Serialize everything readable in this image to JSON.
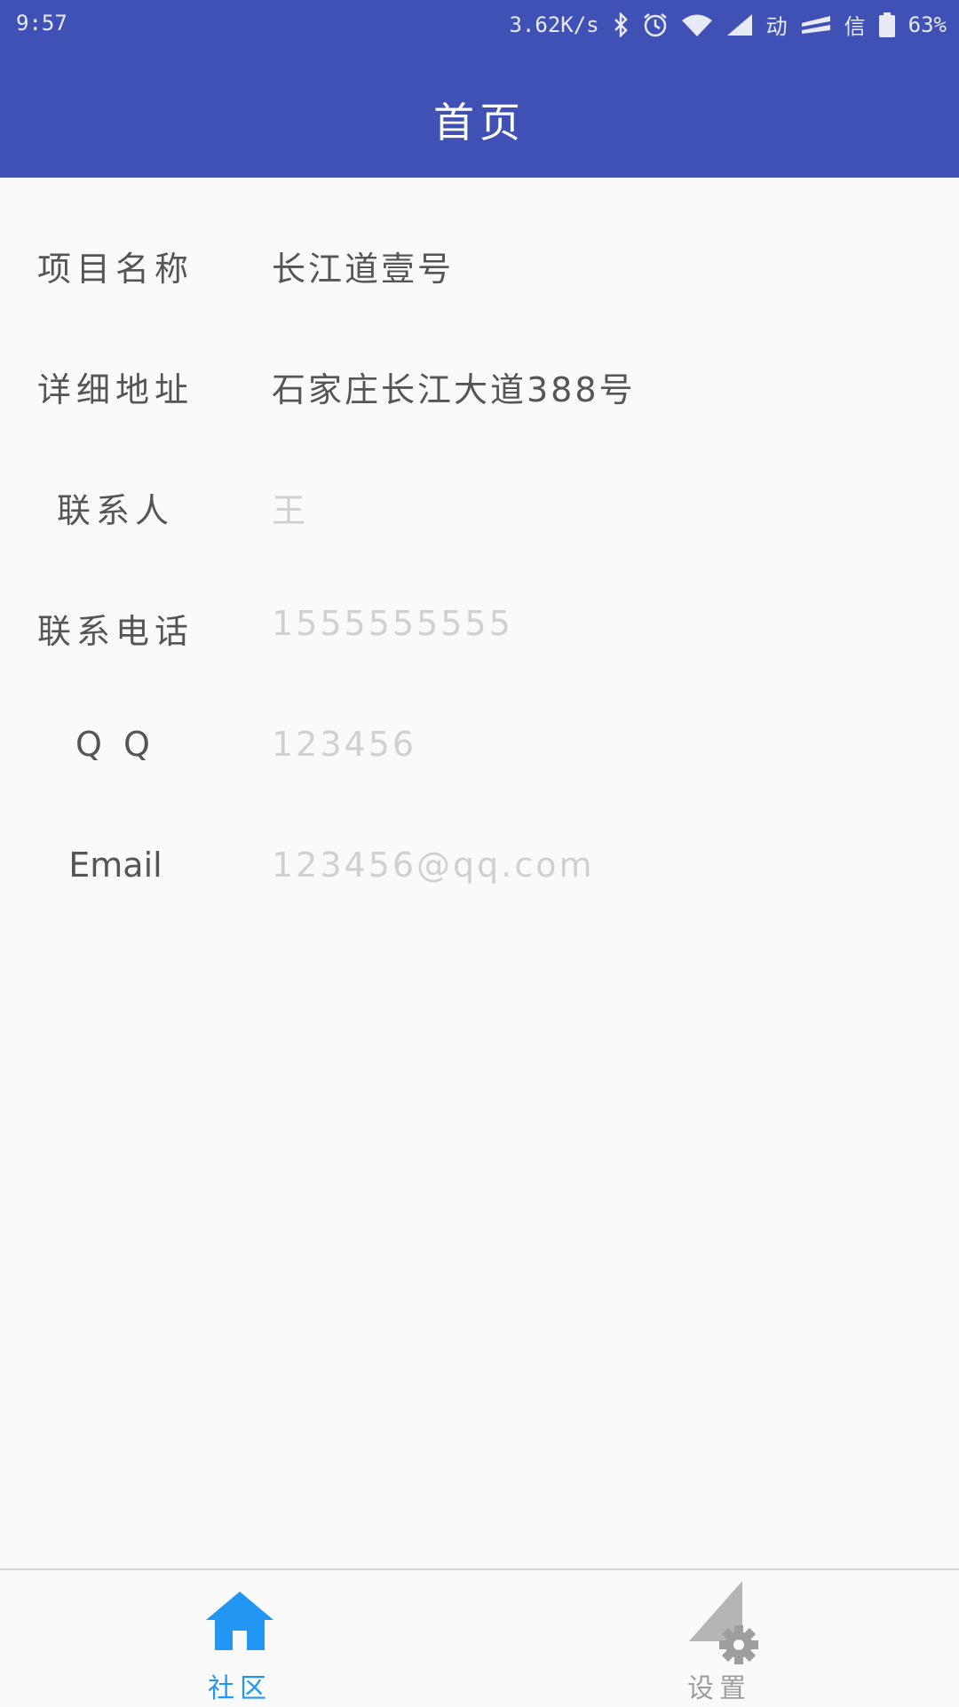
{
  "status_bar": {
    "time": "9:57",
    "network_speed": "3.62K/s",
    "carrier_label": "动",
    "carrier_label_2": "信",
    "battery": "63%"
  },
  "app_bar": {
    "title": "首页"
  },
  "fields": [
    {
      "label": "项目名称",
      "value": "长江道壹号",
      "is_placeholder": false
    },
    {
      "label": "详细地址",
      "value": "石家庄长江大道388号",
      "is_placeholder": false
    },
    {
      "label": "联系人",
      "value": "王",
      "is_placeholder": true
    },
    {
      "label": "联系电话",
      "value": "1555555555",
      "is_placeholder": true
    },
    {
      "label": "Q Q",
      "value": "123456",
      "is_placeholder": true
    },
    {
      "label": "Email",
      "value": "123456@qq.com",
      "is_placeholder": true
    }
  ],
  "bottom_nav": {
    "items": [
      {
        "label": "社区",
        "icon": "home-icon",
        "active": true
      },
      {
        "label": "设置",
        "icon": "settings-icon",
        "active": false
      }
    ]
  },
  "colors": {
    "primary": "#3f51b5",
    "nav_active": "#2196f3",
    "nav_inactive": "#9e9e9e",
    "label_text": "#555555",
    "placeholder_text": "#d0d0d0"
  }
}
